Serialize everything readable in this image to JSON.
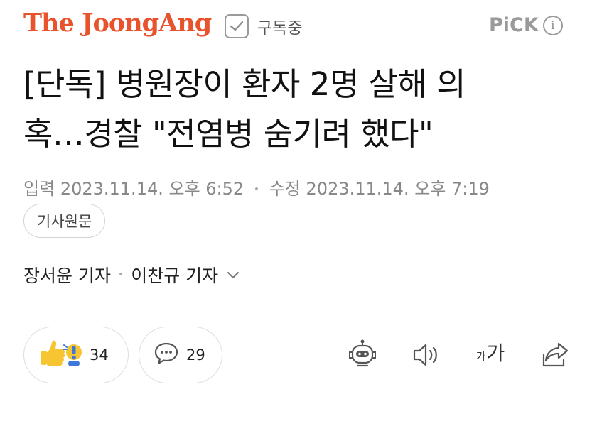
{
  "header": {
    "logo_text": "The JoongAng",
    "subscribe_label": "구독중",
    "pick_label": "PiCK",
    "info_icon": "i"
  },
  "article": {
    "headline_line1": "[단독] 병원장이 환자 2명 살해 의",
    "headline_line2": "혹…경찰 \"전염병 숨기려 했다\"",
    "input_label": "입력",
    "input_date": "2023.11.14. 오후 6:52",
    "modified_label": "수정",
    "modified_date": "2023.11.14. 오후 7:19",
    "original_button": "기사원문",
    "reporter1": "장서윤 기자",
    "reporter2": "이찬규 기자"
  },
  "actions": {
    "reaction_count": "34",
    "comment_count": "29",
    "font_small": "가",
    "font_big": "가"
  },
  "colors": {
    "brand": "#e8522d",
    "reaction_yellow": "#f6c531",
    "reaction_blue": "#3c78d8",
    "muted": "#9a9a9a"
  }
}
